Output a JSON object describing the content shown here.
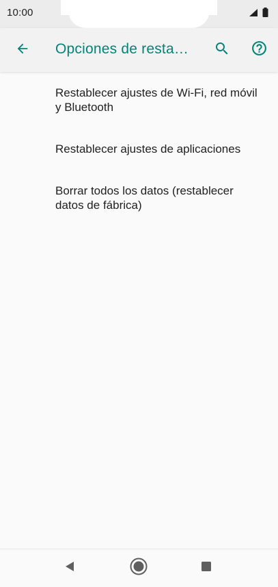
{
  "status_bar": {
    "time": "10:00",
    "icons": [
      "signal-icon",
      "battery-icon"
    ]
  },
  "app_bar": {
    "title": "Opciones de resta…",
    "back_icon": "arrow-back-icon",
    "search_icon": "search-icon",
    "help_icon": "help-circle-icon",
    "accent_color": "#008577"
  },
  "list": {
    "items": [
      {
        "label": "Restablecer ajustes de Wi-Fi, red móvil y Bluetooth"
      },
      {
        "label": "Restablecer ajustes de aplicaciones"
      },
      {
        "label": "Borrar todos los datos (restablecer datos de fábrica)"
      }
    ]
  },
  "nav_bar": {
    "icons": [
      "back-triangle-icon",
      "home-circle-icon",
      "recents-square-icon"
    ]
  }
}
